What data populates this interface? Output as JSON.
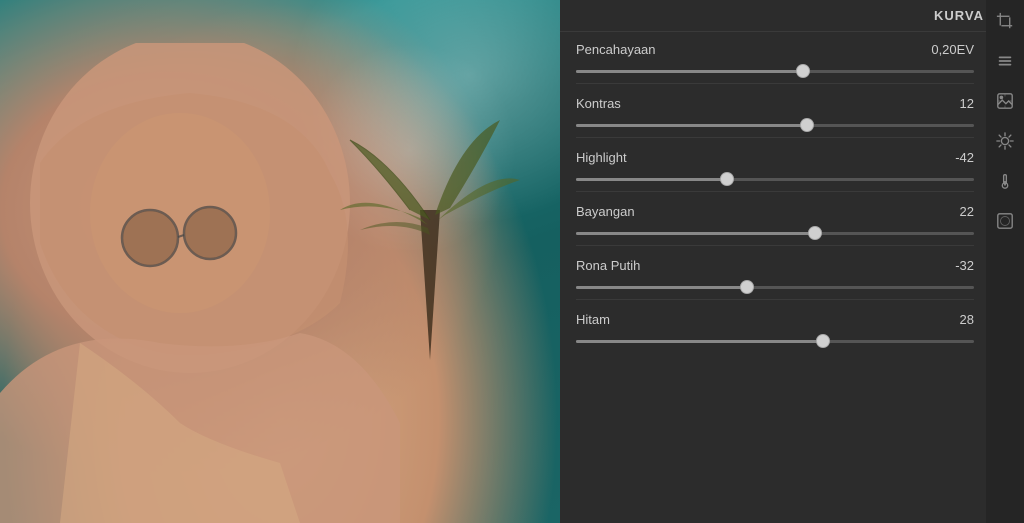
{
  "panel": {
    "header": {
      "kurva_label": "KURVA"
    },
    "sliders": [
      {
        "id": "pencahayaan",
        "label": "Pencahayaan",
        "value": "0,20EV",
        "thumb_pct": 57
      },
      {
        "id": "kontras",
        "label": "Kontras",
        "value": "12",
        "thumb_pct": 58
      },
      {
        "id": "highlight",
        "label": "Highlight",
        "value": "-42",
        "thumb_pct": 38
      },
      {
        "id": "bayangan",
        "label": "Bayangan",
        "value": "22",
        "thumb_pct": 60
      },
      {
        "id": "rona-putih",
        "label": "Rona Putih",
        "value": "-32",
        "thumb_pct": 43
      },
      {
        "id": "hitam",
        "label": "Hitam",
        "value": "28",
        "thumb_pct": 62
      }
    ]
  },
  "sidebar": {
    "icons": [
      {
        "name": "crop-icon",
        "symbol": "⊡"
      },
      {
        "name": "layers-icon",
        "symbol": "❑"
      },
      {
        "name": "image-enhance-icon",
        "symbol": "⊞"
      },
      {
        "name": "brightness-icon",
        "symbol": "✳"
      },
      {
        "name": "temperature-icon",
        "symbol": "⚗"
      },
      {
        "name": "vignette-icon",
        "symbol": "◫"
      }
    ]
  }
}
